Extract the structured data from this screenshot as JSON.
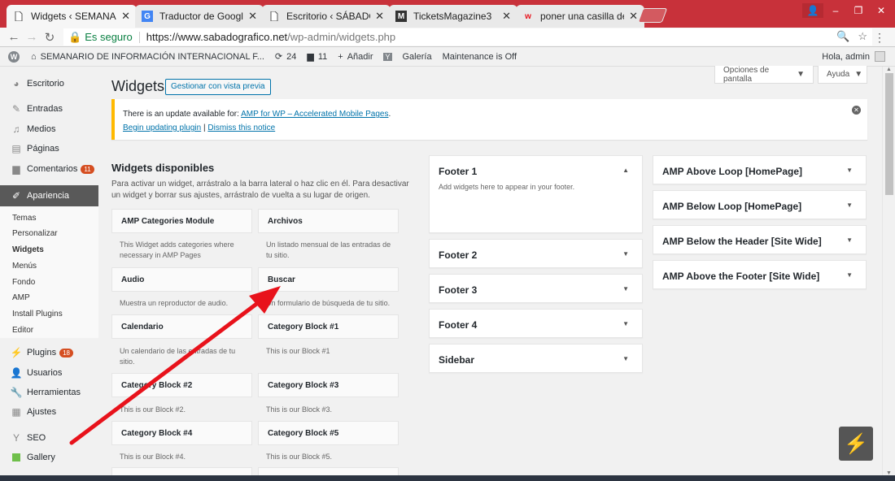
{
  "browser": {
    "tabs": [
      {
        "title": "Widgets ‹ SEMANARIO D",
        "icon": "document-icon"
      },
      {
        "title": "Traductor de Google",
        "icon": "google-translate-icon"
      },
      {
        "title": "Escritorio ‹ SÁBADO GRÁ",
        "icon": "document-icon"
      },
      {
        "title": "TicketsMagazine3",
        "icon": "m-logo-icon"
      },
      {
        "title": "poner una casilla de busc",
        "icon": "w-logo-icon"
      }
    ],
    "secure_label": "Es seguro",
    "url_host": "https://www.sabadografico.net",
    "url_path": "/wp-admin/widgets.php"
  },
  "adminbar": {
    "site_name": "SEMANARIO DE INFORMACIÓN INTERNACIONAL F...",
    "updates_count": "24",
    "comments_count": "11",
    "add_label": "Añadir",
    "gallery_label": "Galería",
    "maintenance_label": "Maintenance is Off",
    "greeting": "Hola, admin"
  },
  "sidebar": {
    "items": [
      {
        "label": "Escritorio",
        "icon": "dashboard-icon"
      },
      {
        "label": "Entradas",
        "icon": "pin-icon"
      },
      {
        "label": "Medios",
        "icon": "media-icon"
      },
      {
        "label": "Páginas",
        "icon": "pages-icon"
      },
      {
        "label": "Comentarios",
        "icon": "comment-icon",
        "badge": "11"
      },
      {
        "label": "Apariencia",
        "icon": "brush-icon"
      },
      {
        "label": "Plugins",
        "icon": "plugin-icon",
        "badge": "18"
      },
      {
        "label": "Usuarios",
        "icon": "user-icon"
      },
      {
        "label": "Herramientas",
        "icon": "wrench-icon"
      },
      {
        "label": "Ajustes",
        "icon": "settings-icon"
      },
      {
        "label": "SEO",
        "icon": "yoast-icon"
      },
      {
        "label": "Gallery",
        "icon": "gallery-icon"
      }
    ],
    "submenu": [
      "Temas",
      "Personalizar",
      "Widgets",
      "Menús",
      "Fondo",
      "AMP",
      "Install Plugins",
      "Editor"
    ]
  },
  "page": {
    "title": "Widgets",
    "preview_button": "Gestionar con vista previa",
    "screen_options": "Opciones de pantalla",
    "help": "Ayuda"
  },
  "notice": {
    "text": "There is an update available for: ",
    "plugin_link": "AMP for WP – Accelerated Mobile Pages",
    "suffix": ".",
    "begin_link": "Begin updating plugin",
    "divider": "|",
    "dismiss_link": "Dismiss this notice"
  },
  "available": {
    "title": "Widgets disponibles",
    "description": "Para activar un widget, arrástralo a la barra lateral o haz clic en él. Para desactivar un widget y borrar sus ajustes, arrástralo de vuelta a su lugar de origen.",
    "widgets": [
      {
        "name": "AMP Categories Module",
        "desc": "This Widget adds categories where necessary in AMP Pages"
      },
      {
        "name": "Archivos",
        "desc": "Un listado mensual de las entradas de tu sitio."
      },
      {
        "name": "Audio",
        "desc": "Muestra un reproductor de audio."
      },
      {
        "name": "Buscar",
        "desc": "Un formulario de búsqueda de tu sitio."
      },
      {
        "name": "Calendario",
        "desc": "Un calendario de las entradas de tu sitio."
      },
      {
        "name": "Category Block #1",
        "desc": "This is our Block #1"
      },
      {
        "name": "Category Block #2",
        "desc": "This is our Block #2."
      },
      {
        "name": "Category Block #3",
        "desc": "This is our Block #3."
      },
      {
        "name": "Category Block #4",
        "desc": "This is our Block #4."
      },
      {
        "name": "Category Block #5",
        "desc": "This is our Block #5."
      }
    ]
  },
  "areas": {
    "col1": [
      {
        "name": "Footer 1",
        "desc": "Add widgets here to appear in your footer.",
        "expanded": true
      },
      {
        "name": "Footer 2"
      },
      {
        "name": "Footer 3"
      },
      {
        "name": "Footer 4"
      },
      {
        "name": "Sidebar"
      }
    ],
    "col2": [
      {
        "name": "AMP Above Loop [HomePage]"
      },
      {
        "name": "AMP Below Loop [HomePage]"
      },
      {
        "name": "AMP Below the Header [Site Wide]"
      },
      {
        "name": "AMP Above the Footer [Site Wide]"
      }
    ]
  },
  "colors": {
    "chrome_frame": "#c8313a",
    "wp_link": "#0073aa",
    "notice_border": "#ffb900",
    "badge": "#d54e21",
    "annotation_arrow": "#e8121b"
  }
}
